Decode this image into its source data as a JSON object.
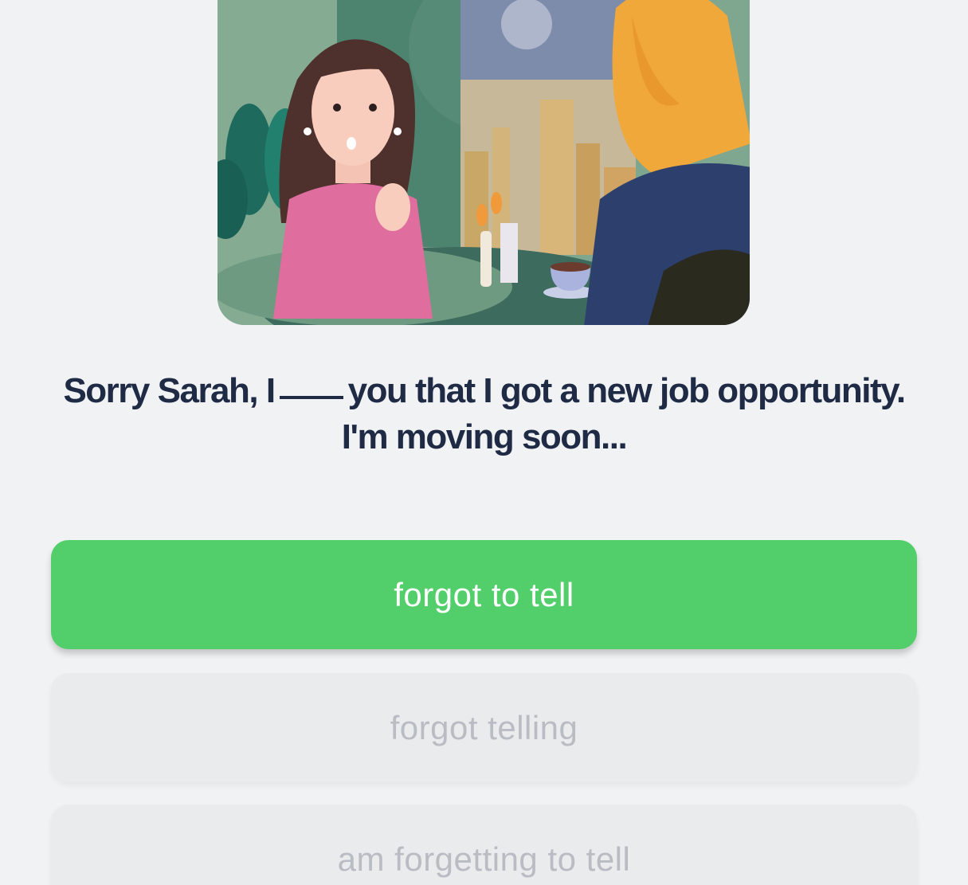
{
  "question": {
    "before_blank": "Sorry Sarah, I",
    "after_blank": "you that I got a new job opportunity.",
    "line2": "I'm moving soon..."
  },
  "options": [
    {
      "label": "forgot to tell",
      "state": "selected"
    },
    {
      "label": "forgot telling",
      "state": "disabled"
    },
    {
      "label": "am forgetting to tell",
      "state": "disabled"
    }
  ],
  "colors": {
    "background": "#f1f2f4",
    "text": "#1f2a44",
    "selected": "#52cf6a",
    "disabled": "#eaebed"
  }
}
